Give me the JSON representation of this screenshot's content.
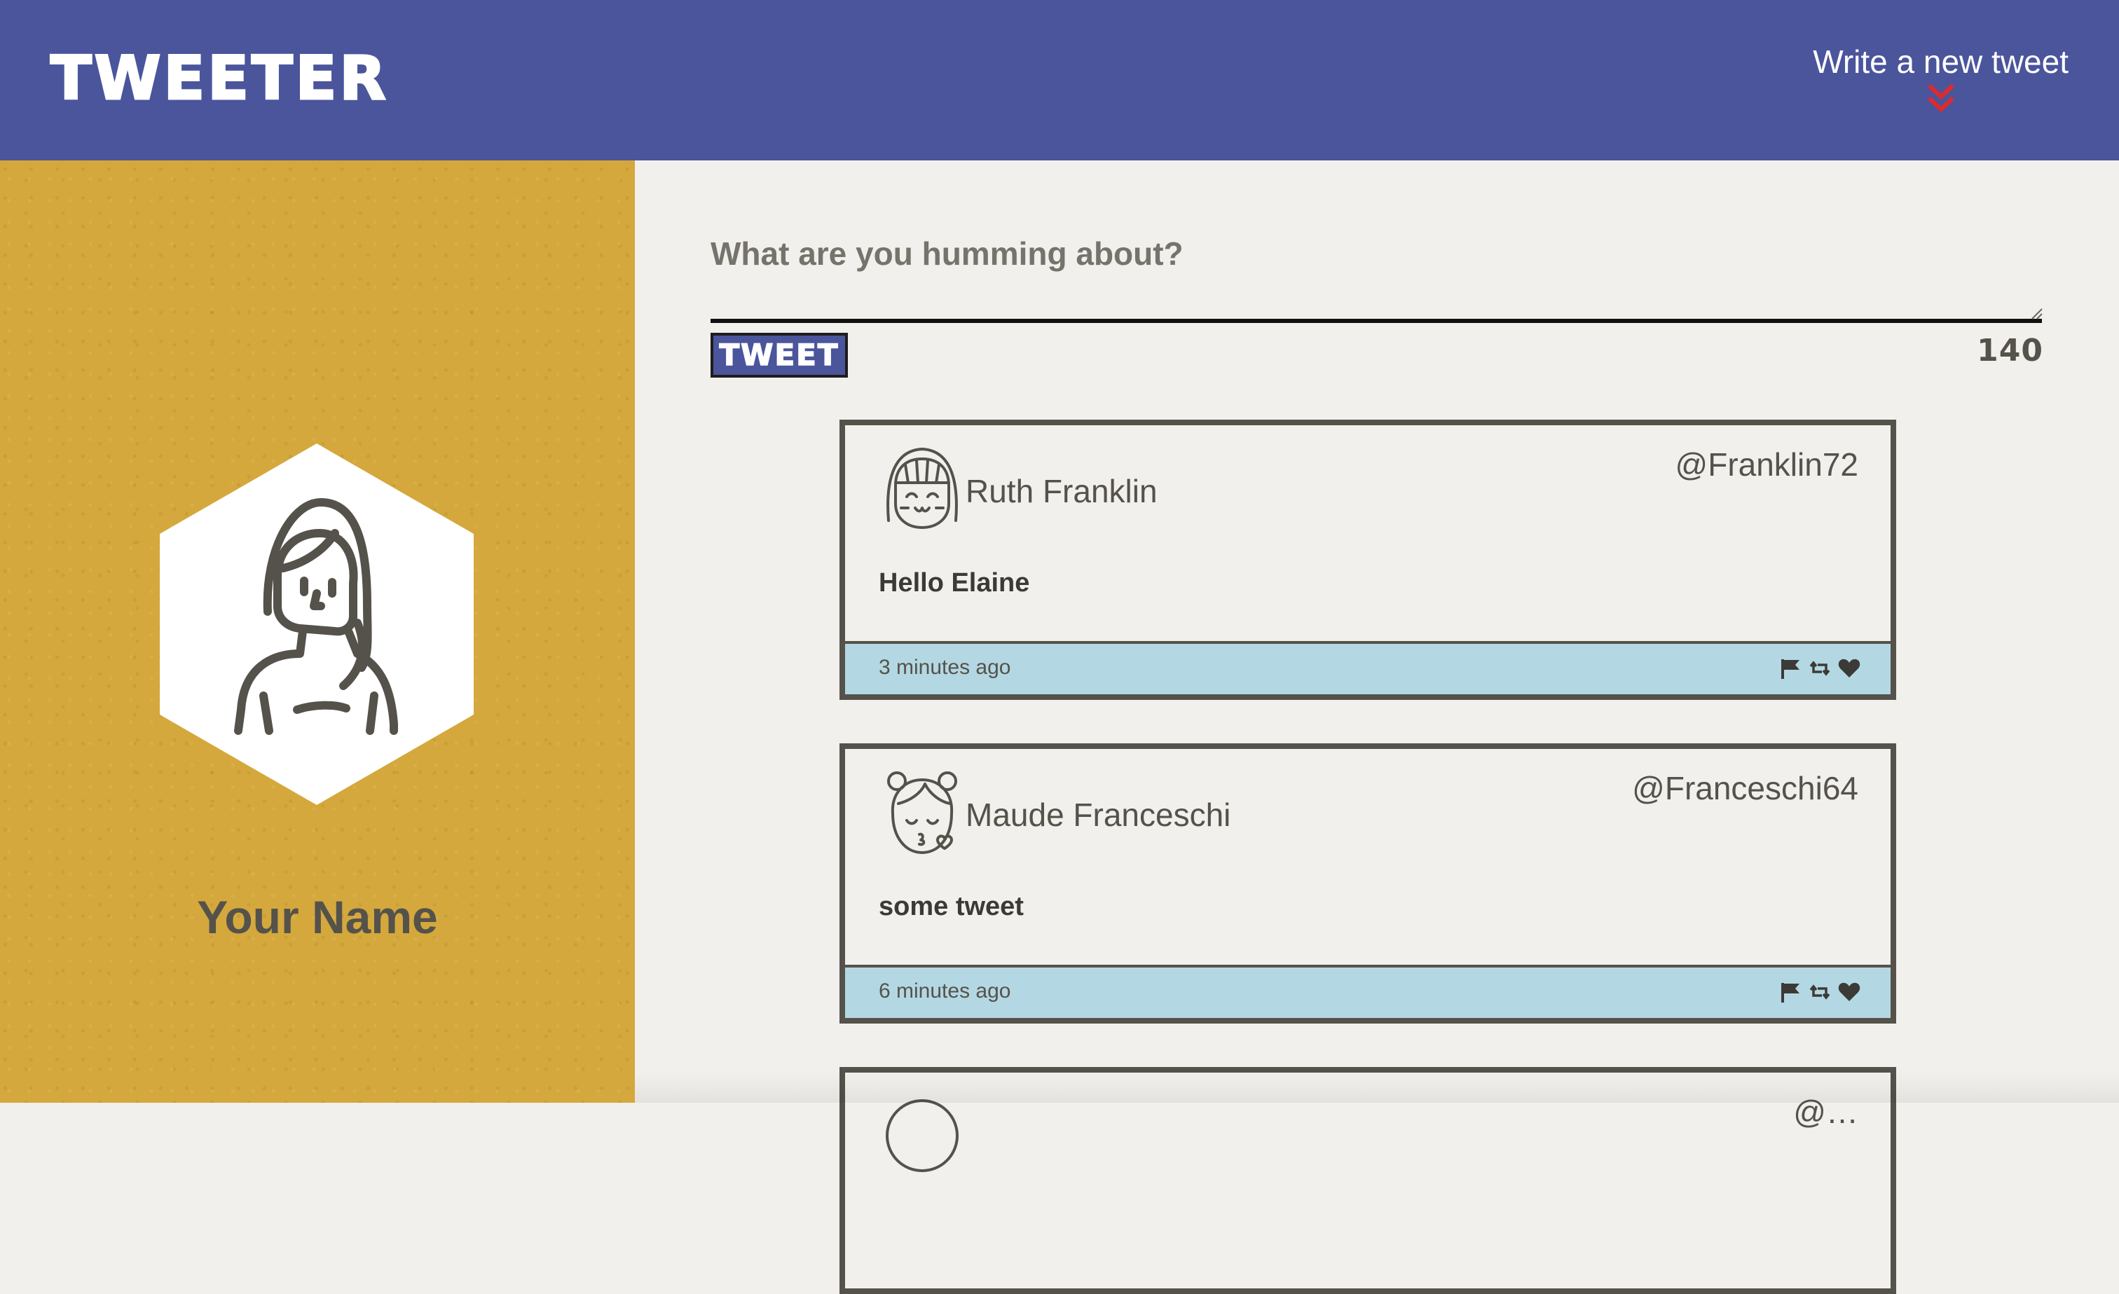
{
  "nav": {
    "brand": "TWEETER",
    "compose_bold": "Write",
    "compose_rest": " a new tweet",
    "chevron_color": "#e02a2a"
  },
  "sidebar": {
    "user_name": "Your Name"
  },
  "composer": {
    "placeholder": "What are you humming about?",
    "button_label": "TWEET",
    "char_count": "140"
  },
  "tweets": [
    {
      "name": "Ruth Franklin",
      "handle": "@Franklin72",
      "text": "Hello Elaine",
      "time": "3 minutes ago",
      "avatar": "girl-smiling-icon"
    },
    {
      "name": "Maude Franceschi",
      "handle": "@Franceschi64",
      "text": "some tweet",
      "time": "6 minutes ago",
      "avatar": "girl-kiss-icon"
    },
    {
      "name": "",
      "handle": "@…",
      "text": "",
      "time": "",
      "avatar": "person-icon"
    }
  ],
  "colors": {
    "nav": "#4b559c",
    "sidebar": "#d4a83c",
    "card_border": "#55524b",
    "card_footer": "#b3d8e3",
    "background": "#f2f0ec"
  }
}
